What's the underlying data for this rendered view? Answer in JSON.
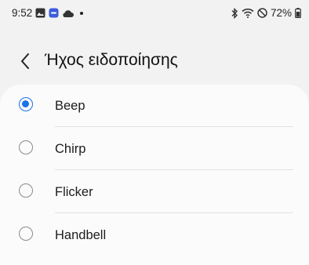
{
  "status_bar": {
    "time": "9:52",
    "left_icons": [
      "gallery-icon",
      "app-notification-icon",
      "cloud-icon"
    ],
    "right_icons": [
      "bluetooth-icon",
      "wifi-icon",
      "do-not-disturb-icon",
      "battery-icon"
    ],
    "battery_percent": "72%"
  },
  "header": {
    "back_icon": "chevron-left-icon",
    "title": "Ήχος ειδοποίησης"
  },
  "options": [
    {
      "label": "Beep",
      "selected": true
    },
    {
      "label": "Chirp",
      "selected": false
    },
    {
      "label": "Flicker",
      "selected": false
    },
    {
      "label": "Handbell",
      "selected": false
    }
  ],
  "colors": {
    "accent": "#1a73e8",
    "background": "#f2f2f2",
    "card": "#fbfbfb"
  }
}
